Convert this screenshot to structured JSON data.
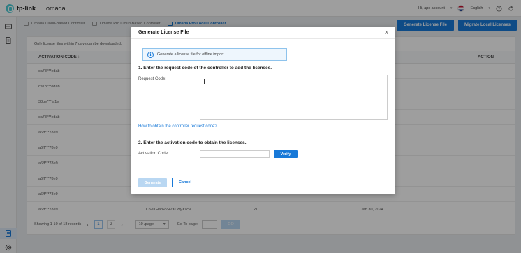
{
  "header": {
    "brand": "tp-link",
    "product": "omada",
    "account_text": "Hi, aps account",
    "language": "English"
  },
  "breadcrumb": [
    {
      "label": "Omada Cloud-Based Controller"
    },
    {
      "label": "Omada Pro Cloud-Based Controller"
    },
    {
      "label": "Omada Pro Local Controller"
    }
  ],
  "actions": {
    "generate_license_file": "Generate License File",
    "migrate_local_licenses": "Migrate Local Licenses"
  },
  "table": {
    "hint": "Only license files within 7 days can be downloaded.",
    "columns": {
      "activation_code": "ACTIVATION CODE",
      "sort_indicator": "↕",
      "action": "ACTION"
    },
    "rows": [
      {
        "activation_code": "ca78***edab"
      },
      {
        "activation_code": "ca78***edab"
      },
      {
        "activation_code": "38be***fa1e"
      },
      {
        "activation_code": "ca78***edab"
      },
      {
        "activation_code": "a6ff***78e9"
      },
      {
        "activation_code": "a6ff***78e9"
      },
      {
        "activation_code": "a6ff***78e9"
      },
      {
        "activation_code": "a6ff***78e9"
      },
      {
        "activation_code": "a6ff***78e9"
      },
      {
        "activation_code": "a6ff***78e9",
        "request_code": "CSeTHa3PvR2XLWyXzcV...",
        "quantity": "21",
        "date": "Jan 30, 2024"
      }
    ]
  },
  "pagination": {
    "summary": "Showing 1-10 of 18 records",
    "prev": "‹",
    "next": "›",
    "pages": [
      "1",
      "2"
    ],
    "current_page": "1",
    "page_size": "10 /page",
    "goto_label": "Go To page:",
    "go_button": "GO"
  },
  "modal": {
    "title": "Generate License File",
    "close": "×",
    "info": "Generate a license file for offline import.",
    "step1_title": "1. Enter the request code of the controller to add the licenses.",
    "request_code_label": "Request Code:",
    "request_code_value": "",
    "help_link": "How to obtain the controller request code?",
    "step2_title": "2. Enter the activation code to obtain the licenses.",
    "activation_code_label": "Activation Code:",
    "activation_code_value": "",
    "verify_button": "Verify",
    "generate_button": "Generate",
    "cancel_button": "Cancel"
  },
  "colors": {
    "primary": "#1879d8",
    "primary_disabled": "#b9d7f2",
    "link": "#1879d8",
    "info_border": "#8ec3ec"
  }
}
